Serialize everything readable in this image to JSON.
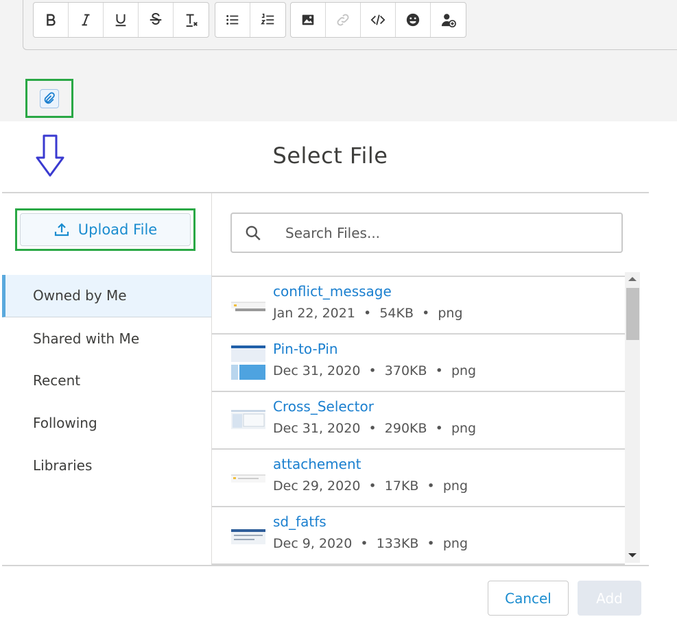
{
  "toolbar": {
    "groups": [
      [
        "bold-icon",
        "italic-icon",
        "underline-icon",
        "strikethrough-icon",
        "clear-format-icon"
      ],
      [
        "bulleted-list-icon",
        "numbered-list-icon"
      ],
      [
        "image-icon",
        "link-icon",
        "code-icon",
        "emoji-icon",
        "mention-user-icon"
      ]
    ]
  },
  "attach": {
    "icon": "paperclip-icon"
  },
  "annotation": {
    "arrow": "down-arrow-icon",
    "highlight_color": "#2aa845",
    "arrow_color": "#3a3ad0"
  },
  "dialog": {
    "title": "Select File",
    "upload_label": "Upload File",
    "search_placeholder": "Search Files...",
    "nav": [
      "Owned by Me",
      "Shared with Me",
      "Recent",
      "Following",
      "Libraries"
    ],
    "active_nav": "Owned by Me",
    "files": [
      {
        "name": "conflict_message",
        "date": "Jan 22, 2021",
        "size": "54KB",
        "type": "png"
      },
      {
        "name": "Pin-to-Pin",
        "date": "Dec 31, 2020",
        "size": "370KB",
        "type": "png"
      },
      {
        "name": "Cross_Selector",
        "date": "Dec 31, 2020",
        "size": "290KB",
        "type": "png"
      },
      {
        "name": "attachement",
        "date": "Dec 29, 2020",
        "size": "17KB",
        "type": "png"
      },
      {
        "name": "sd_fatfs",
        "date": "Dec 9, 2020",
        "size": "133KB",
        "type": "png"
      }
    ],
    "cancel_label": "Cancel",
    "add_label": "Add"
  },
  "colors": {
    "accent": "#1a8ccf",
    "link": "#1a7fcf",
    "active_bg": "#eaf4fd"
  }
}
